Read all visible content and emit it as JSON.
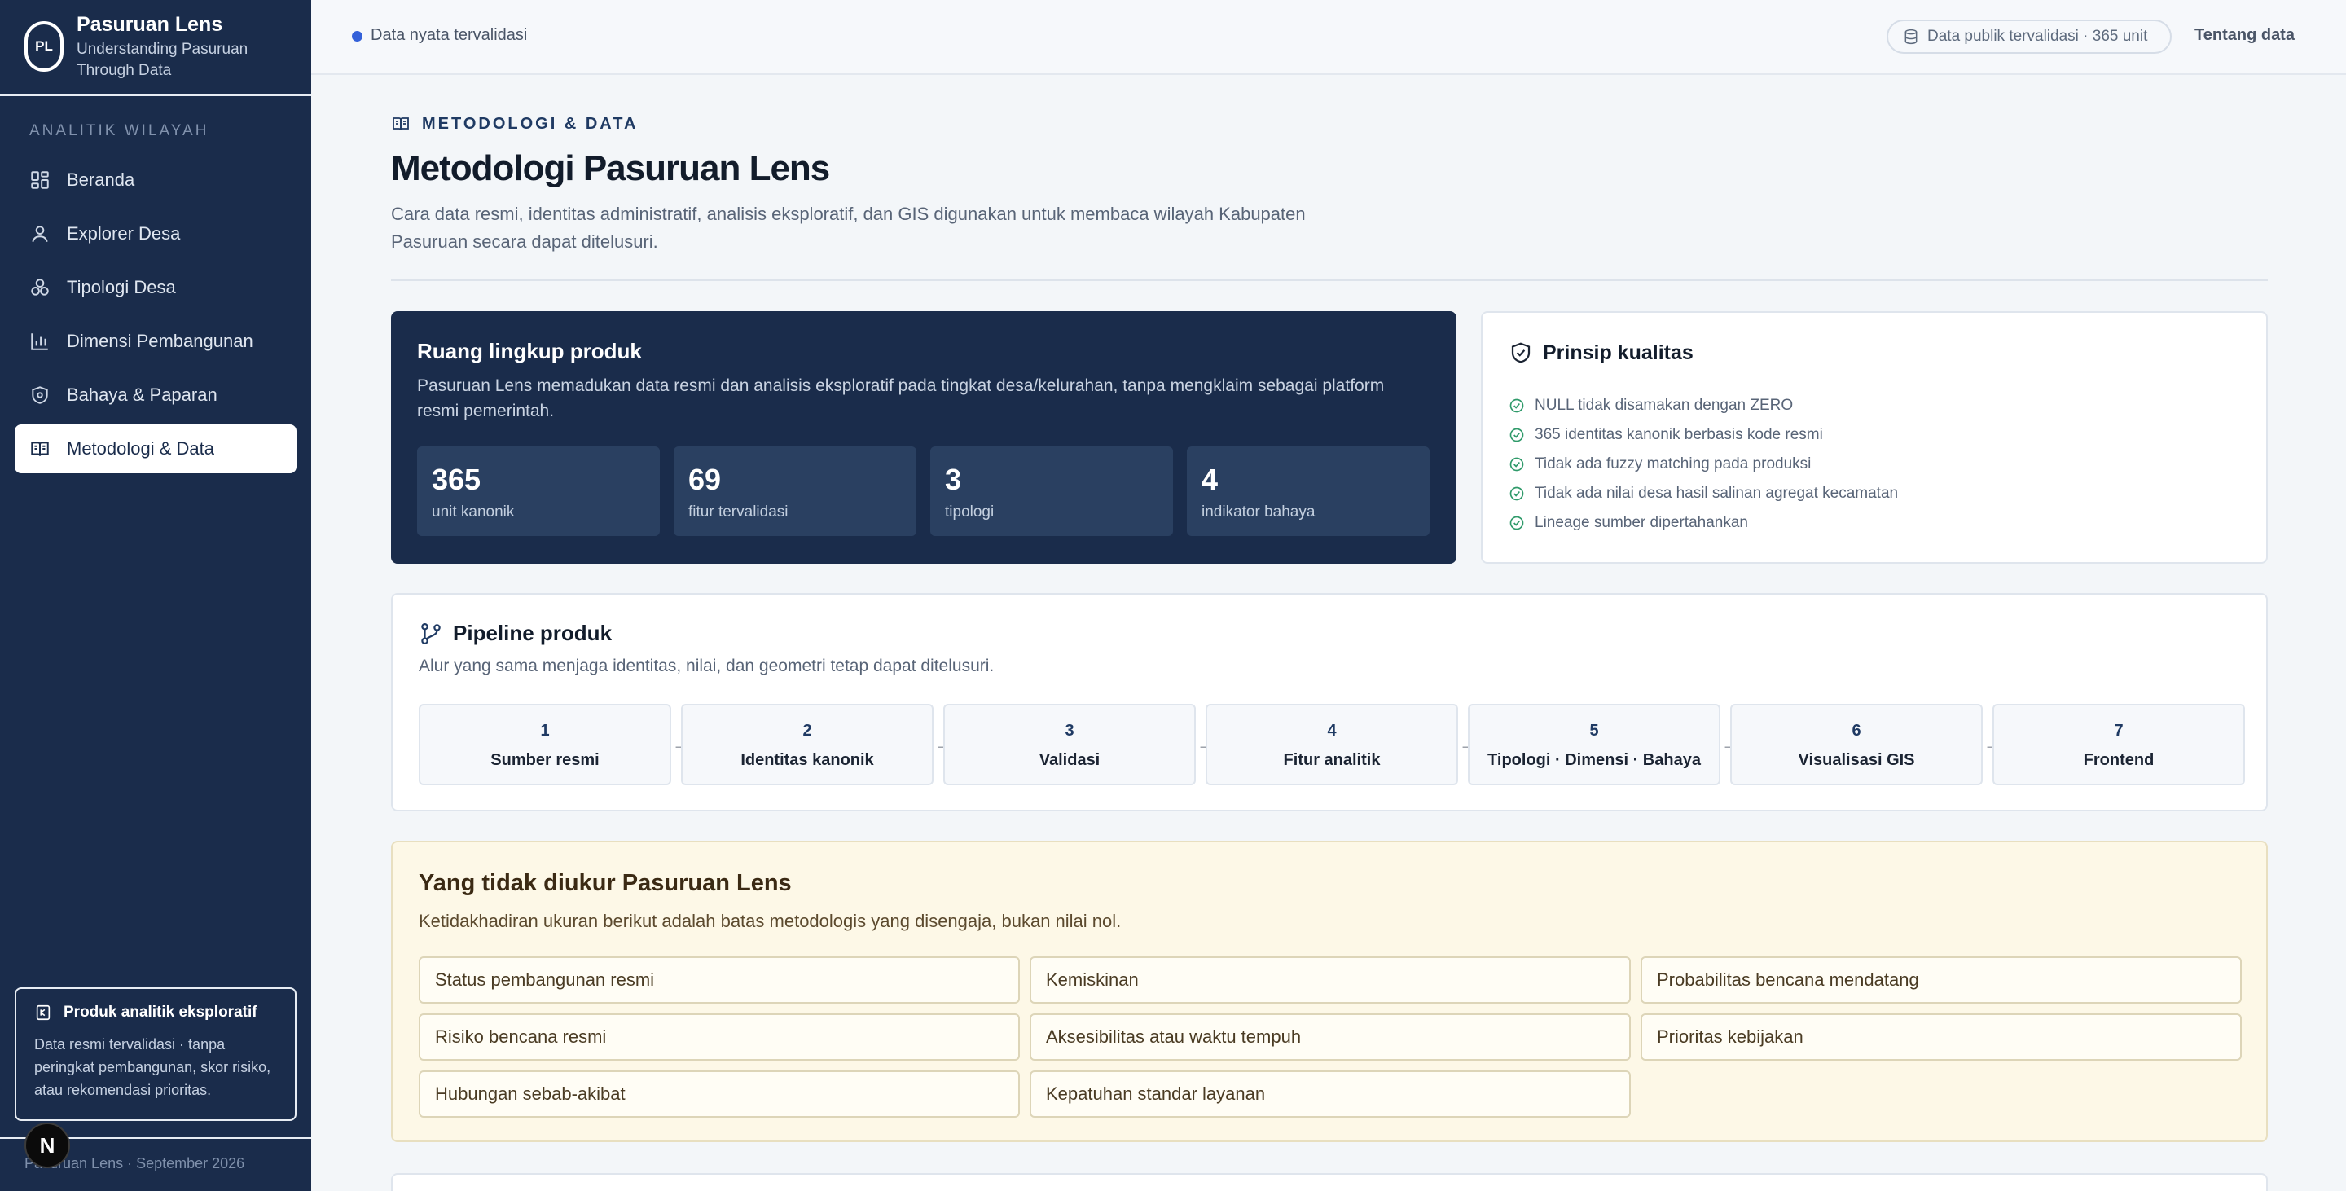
{
  "brand": {
    "logo_text": "PL",
    "title": "Pasuruan Lens",
    "subtitle": "Understanding Pasuruan Through Data"
  },
  "sidebar": {
    "section_label": "ANALITIK WILAYAH",
    "items": [
      {
        "label": "Beranda",
        "icon": "grid-icon",
        "active": false
      },
      {
        "label": "Explorer Desa",
        "icon": "user-pin-icon",
        "active": false
      },
      {
        "label": "Tipologi Desa",
        "icon": "cluster-icon",
        "active": false
      },
      {
        "label": "Dimensi Pembangunan",
        "icon": "bar-chart-icon",
        "active": false
      },
      {
        "label": "Bahaya & Paparan",
        "icon": "shield-icon",
        "active": false
      },
      {
        "label": "Metodologi & Data",
        "icon": "book-icon",
        "active": true
      }
    ],
    "info_card": {
      "title": "Produk analitik eksploratif",
      "text": "Data resmi tervalidasi · tanpa peringkat pembangunan, skor risiko, atau rekomendasi prioritas."
    },
    "footer": "Pasuruan Lens · September 2026",
    "floating_badge": "N"
  },
  "topbar": {
    "status": "Data nyata tervalidasi",
    "pill": "Data publik tervalidasi · 365 unit",
    "link": "Tentang data"
  },
  "header": {
    "eyebrow": "METODOLOGI & DATA",
    "title": "Metodologi Pasuruan Lens",
    "description": "Cara data resmi, identitas administratif, analisis eksploratif, dan GIS digunakan untuk membaca wilayah Kabupaten Pasuruan secara dapat ditelusuri."
  },
  "scope": {
    "title": "Ruang lingkup produk",
    "description": "Pasuruan Lens memadukan data resmi dan analisis eksploratif pada tingkat desa/kelurahan, tanpa mengklaim sebagai platform resmi pemerintah.",
    "stats": [
      {
        "value": "365",
        "label": "unit kanonik"
      },
      {
        "value": "69",
        "label": "fitur tervalidasi"
      },
      {
        "value": "3",
        "label": "tipologi"
      },
      {
        "value": "4",
        "label": "indikator bahaya"
      }
    ]
  },
  "quality": {
    "title": "Prinsip kualitas",
    "items": [
      "NULL tidak disamakan dengan ZERO",
      "365 identitas kanonik berbasis kode resmi",
      "Tidak ada fuzzy matching pada produksi",
      "Tidak ada nilai desa hasil salinan agregat kecamatan",
      "Lineage sumber dipertahankan"
    ]
  },
  "pipeline": {
    "title": "Pipeline produk",
    "description": "Alur yang sama menjaga identitas, nilai, dan geometri tetap dapat ditelusuri.",
    "steps": [
      {
        "num": "1",
        "label": "Sumber resmi"
      },
      {
        "num": "2",
        "label": "Identitas kanonik"
      },
      {
        "num": "3",
        "label": "Validasi"
      },
      {
        "num": "4",
        "label": "Fitur analitik"
      },
      {
        "num": "5",
        "label": "Tipologi · Dimensi · Bahaya"
      },
      {
        "num": "6",
        "label": "Visualisasi GIS"
      },
      {
        "num": "7",
        "label": "Frontend"
      }
    ]
  },
  "not_measured": {
    "title": "Yang tidak diukur Pasuruan Lens",
    "description": "Ketidakhadiran ukuran berikut adalah batas metodologis yang disengaja, bukan nilai nol.",
    "items": [
      "Status pembangunan resmi",
      "Kemiskinan",
      "Probabilitas bencana mendatang",
      "Risiko bencana resmi",
      "Aksesibilitas atau waktu tempuh",
      "Prioritas kebijakan",
      "Hubungan sebab-akibat",
      "Kepatuhan standar layanan"
    ]
  },
  "colors": {
    "sidebar_bg": "#1a2c4b",
    "accent": "#3461d9",
    "success": "#2f9a6a",
    "warning_bg": "#fdf8e7"
  }
}
